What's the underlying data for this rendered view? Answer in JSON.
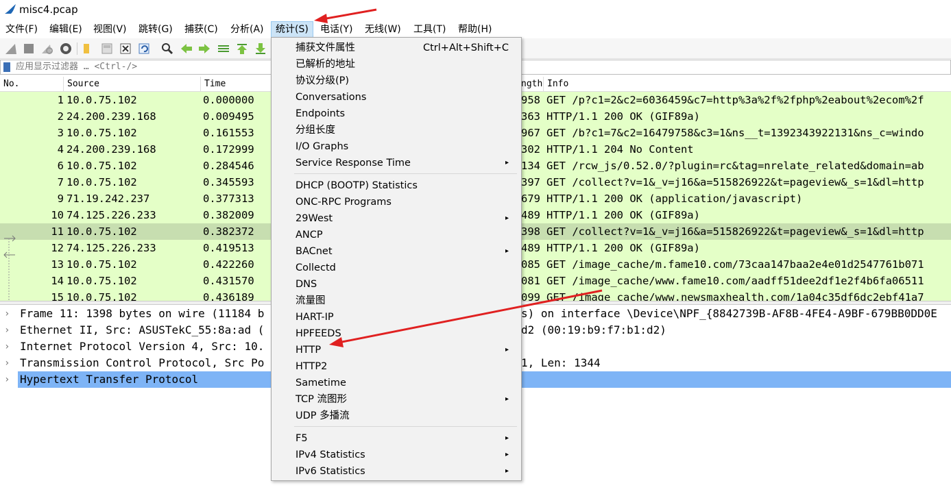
{
  "window": {
    "title": "misc4.pcap"
  },
  "menubar": [
    {
      "name": "menu-file",
      "label": "文件(F)"
    },
    {
      "name": "menu-edit",
      "label": "编辑(E)"
    },
    {
      "name": "menu-view",
      "label": "视图(V)"
    },
    {
      "name": "menu-go",
      "label": "跳转(G)"
    },
    {
      "name": "menu-capture",
      "label": "捕获(C)"
    },
    {
      "name": "menu-analyze",
      "label": "分析(A)"
    },
    {
      "name": "menu-statistics",
      "label": "统计(S)"
    },
    {
      "name": "menu-telephony",
      "label": "电话(Y)"
    },
    {
      "name": "menu-wireless",
      "label": "无线(W)"
    },
    {
      "name": "menu-tools",
      "label": "工具(T)"
    },
    {
      "name": "menu-help",
      "label": "帮助(H)"
    }
  ],
  "filter": {
    "placeholder": "应用显示过滤器 … <Ctrl-/>"
  },
  "packet_list": {
    "columns": {
      "no": "No.",
      "source": "Source",
      "time": "Time",
      "length": "ngth",
      "info": "Info"
    },
    "rows": [
      {
        "no": "1",
        "source": "10.0.75.102",
        "time": "0.000000",
        "length": "958",
        "info": "GET /p?c1=2&c2=6036459&c7=http%3a%2f%2fphp%2eabout%2ecom%2f"
      },
      {
        "no": "2",
        "source": "24.200.239.168",
        "time": "0.009495",
        "length": "363",
        "info": "HTTP/1.1 200 OK  (GIF89a)"
      },
      {
        "no": "3",
        "source": "10.0.75.102",
        "time": "0.161553",
        "length": "967",
        "info": "GET /b?c1=7&c2=16479758&c3=1&ns__t=1392343922131&ns_c=windo"
      },
      {
        "no": "4",
        "source": "24.200.239.168",
        "time": "0.172999",
        "length": "302",
        "info": "HTTP/1.1 204 No Content"
      },
      {
        "no": "6",
        "source": "10.0.75.102",
        "time": "0.284546",
        "length": "134",
        "info": "GET /rcw_js/0.52.0/?plugin=rc&tag=nrelate_related&domain=ab"
      },
      {
        "no": "7",
        "source": "10.0.75.102",
        "time": "0.345593",
        "length": "397",
        "info": "GET /collect?v=1&_v=j16&a=515826922&t=pageview&_s=1&dl=http"
      },
      {
        "no": "9",
        "source": "71.19.242.237",
        "time": "0.377313",
        "length": "679",
        "info": "HTTP/1.1 200 OK  (application/javascript)"
      },
      {
        "no": "10",
        "source": "74.125.226.233",
        "time": "0.382009",
        "length": "489",
        "info": "HTTP/1.1 200 OK  (GIF89a)"
      },
      {
        "no": "11",
        "source": "10.0.75.102",
        "time": "0.382372",
        "length": "398",
        "info": "GET /collect?v=1&_v=j16&a=515826922&t=pageview&_s=1&dl=http",
        "selected": true
      },
      {
        "no": "12",
        "source": "74.125.226.233",
        "time": "0.419513",
        "length": "489",
        "info": "HTTP/1.1 200 OK  (GIF89a)"
      },
      {
        "no": "13",
        "source": "10.0.75.102",
        "time": "0.422260",
        "length": "085",
        "info": "GET /image_cache/m.fame10.com/73caa147baa2e4e01d2547761b071"
      },
      {
        "no": "14",
        "source": "10.0.75.102",
        "time": "0.431570",
        "length": "081",
        "info": "GET /image_cache/www.fame10.com/aadff51dee2df1e2f4b6fa06511"
      },
      {
        "no": "15",
        "source": "10.0.75.102",
        "time": "0.436189",
        "length": "099",
        "info": "GET /image_cache/www.newsmaxhealth.com/1a04c35df6dc2ebf41a7"
      }
    ]
  },
  "details": [
    {
      "left": "Frame 11: 1398 bytes on wire (11184 b",
      "right": "s) on interface \\Device\\NPF_{8842739B-AF8B-4FE4-A9BF-679BB0DD0E"
    },
    {
      "left": "Ethernet II, Src: ASUSTekC_55:8a:ad (",
      "right": "d2 (00:19:b9:f7:b1:d2)"
    },
    {
      "left": "Internet Protocol Version 4, Src: 10.",
      "right": ""
    },
    {
      "left": "Transmission Control Protocol, Src Po",
      "right": "1, Len: 1344"
    },
    {
      "left": "Hypertext Transfer Protocol",
      "right": "",
      "selected": true
    }
  ],
  "statistics_menu": {
    "groups": [
      [
        {
          "label": "捕获文件属性",
          "shortcut": "Ctrl+Alt+Shift+C"
        },
        {
          "label": "已解析的地址"
        },
        {
          "label": "协议分级(P)"
        },
        {
          "label": "Conversations"
        },
        {
          "label": "Endpoints"
        },
        {
          "label": "分组长度"
        },
        {
          "label": "I/O Graphs"
        },
        {
          "label": "Service Response Time",
          "submenu": true
        }
      ],
      [
        {
          "label": "DHCP (BOOTP) Statistics"
        },
        {
          "label": "ONC-RPC Programs"
        },
        {
          "label": "29West",
          "submenu": true
        },
        {
          "label": "ANCP"
        },
        {
          "label": "BACnet",
          "submenu": true
        },
        {
          "label": "Collectd"
        },
        {
          "label": "DNS"
        },
        {
          "label": "流量图"
        },
        {
          "label": "HART-IP"
        },
        {
          "label": "HPFEEDS"
        },
        {
          "label": "HTTP",
          "submenu": true
        },
        {
          "label": "HTTP2"
        },
        {
          "label": "Sametime"
        },
        {
          "label": "TCP 流图形",
          "submenu": true
        },
        {
          "label": "UDP 多播流"
        }
      ],
      [
        {
          "label": "F5",
          "submenu": true
        },
        {
          "label": "IPv4 Statistics",
          "submenu": true
        },
        {
          "label": "IPv6 Statistics",
          "submenu": true
        }
      ]
    ]
  },
  "colors": {
    "packet_row_bg": "#e4ffc7",
    "packet_row_selected_bg": "#c7deb0",
    "detail_selected_bg": "#7eb4f6",
    "menu_bg": "#f2f2f2",
    "annotation_arrow": "#e02020"
  }
}
